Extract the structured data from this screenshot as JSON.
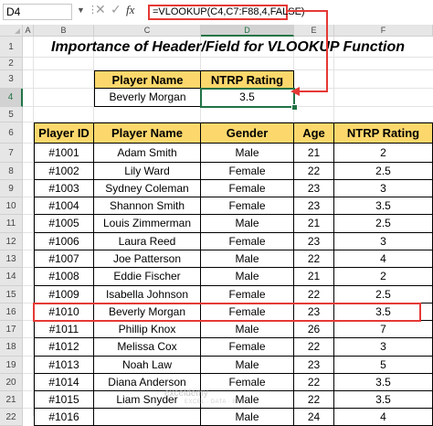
{
  "formula_bar": {
    "name_box": "D4",
    "formula": "=VLOOKUP(C4,C7:F88,4,FALSE)",
    "fx_label": "fx"
  },
  "columns": [
    "A",
    "B",
    "C",
    "D",
    "E",
    "F"
  ],
  "active_column": "D",
  "active_row": "4",
  "rows": [
    "1",
    "2",
    "3",
    "4",
    "5",
    "6",
    "7",
    "8",
    "9",
    "10",
    "11",
    "12",
    "13",
    "14",
    "15",
    "16",
    "17",
    "18",
    "19",
    "20",
    "21",
    "22"
  ],
  "title": "Importance of Header/Field for VLOOKUP Function",
  "lookup": {
    "headers": [
      "Player Name",
      "NTRP Rating"
    ],
    "values": [
      "Beverly Morgan",
      "3.5"
    ]
  },
  "table": {
    "headers": [
      "Player ID",
      "Player Name",
      "Gender",
      "Age",
      "NTRP Rating"
    ],
    "rows": [
      [
        "#1001",
        "Adam Smith",
        "Male",
        "21",
        "2"
      ],
      [
        "#1002",
        "Lily Ward",
        "Female",
        "22",
        "2.5"
      ],
      [
        "#1003",
        "Sydney Coleman",
        "Female",
        "23",
        "3"
      ],
      [
        "#1004",
        "Shannon Smith",
        "Female",
        "23",
        "3.5"
      ],
      [
        "#1005",
        "Louis Zimmerman",
        "Male",
        "21",
        "2.5"
      ],
      [
        "#1006",
        "Laura Reed",
        "Female",
        "23",
        "3"
      ],
      [
        "#1007",
        "Joe Patterson",
        "Male",
        "22",
        "4"
      ],
      [
        "#1008",
        "Eddie Fischer",
        "Male",
        "21",
        "2"
      ],
      [
        "#1009",
        "Isabella Johnson",
        "Female",
        "22",
        "2.5"
      ],
      [
        "#1010",
        "Beverly Morgan",
        "Female",
        "23",
        "3.5"
      ],
      [
        "#1011",
        "Phillip Knox",
        "Male",
        "26",
        "7"
      ],
      [
        "#1012",
        "Melissa Cox",
        "Female",
        "22",
        "3"
      ],
      [
        "#1013",
        "Noah Law",
        "Male",
        "23",
        "5"
      ],
      [
        "#1014",
        "Diana Anderson",
        "Female",
        "22",
        "3.5"
      ],
      [
        "#1015",
        "Liam Snyder",
        "Male",
        "22",
        "3.5"
      ],
      [
        "#1016",
        "",
        "Male",
        "24",
        "4"
      ]
    ]
  },
  "highlighted_row": "#1010",
  "watermark": {
    "brand": "exceldemy",
    "tagline": "EXCEL · DATA · BI"
  },
  "colors": {
    "header_fill": "#fcd86c",
    "accent_red": "#e53935",
    "excel_green": "#217346"
  }
}
